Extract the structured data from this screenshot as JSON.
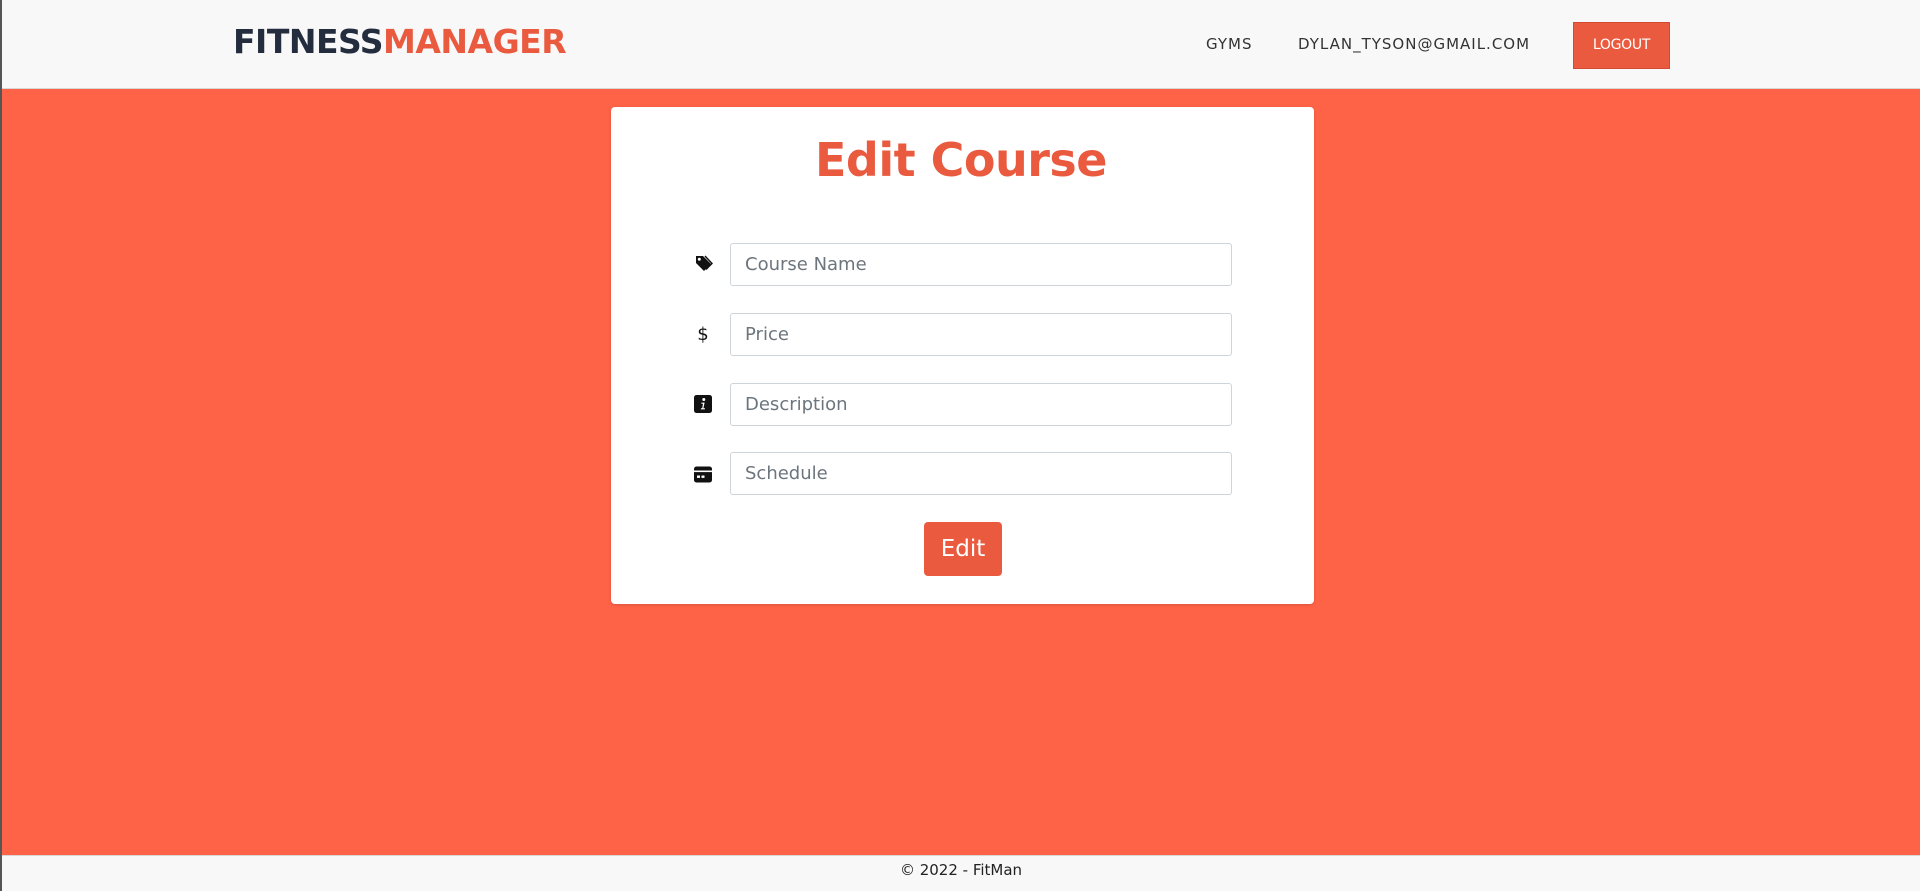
{
  "navbar": {
    "brand_part1": "FITNESS",
    "brand_part2": "MANAGER",
    "links": [
      {
        "label": "GYMS"
      },
      {
        "label": "DYLAN_TYSON@GMAIL.COM"
      }
    ],
    "logout_label": "LOGOUT"
  },
  "form": {
    "title": "Edit Course",
    "fields": [
      {
        "icon": "tag-icon",
        "placeholder": "Course Name",
        "value": ""
      },
      {
        "icon": "dollar-icon",
        "placeholder": "Price",
        "value": ""
      },
      {
        "icon": "info-icon",
        "placeholder": "Description",
        "value": ""
      },
      {
        "icon": "calendar-icon",
        "placeholder": "Schedule",
        "value": ""
      }
    ],
    "dollar_symbol": "$",
    "submit_label": "Edit"
  },
  "footer": {
    "text": "© 2022 - FitMan"
  },
  "colors": {
    "accent": "#ea5a3f",
    "background": "#ff6347",
    "navbar_bg": "#f8f8f9",
    "brand_dark": "#232d3d"
  }
}
